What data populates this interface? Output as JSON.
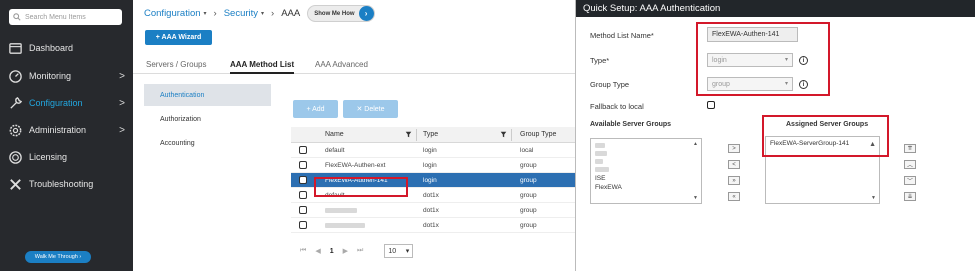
{
  "sidebar": {
    "search_placeholder": "Search Menu Items",
    "items": [
      {
        "label": "Dashboard",
        "icon": "dashboard-icon"
      },
      {
        "label": "Monitoring",
        "icon": "monitoring-icon",
        "chevron": ">"
      },
      {
        "label": "Configuration",
        "icon": "wrench-icon",
        "chevron": ">",
        "active": true
      },
      {
        "label": "Administration",
        "icon": "gear-icon",
        "chevron": ">"
      },
      {
        "label": "Licensing",
        "icon": "licensing-icon"
      },
      {
        "label": "Troubleshooting",
        "icon": "tools-icon"
      }
    ],
    "walk_me": "Walk Me Through ›"
  },
  "breadcrumb": {
    "configuration": "Configuration",
    "security": "Security",
    "current": "AAA",
    "show_me": "Show Me How"
  },
  "wizard_button": "+ AAA Wizard",
  "tabs": [
    "Servers / Groups",
    "AAA Method List",
    "AAA Advanced"
  ],
  "left_menu": [
    "Authentication",
    "Authorization",
    "Accounting"
  ],
  "actions": {
    "add": "+ Add",
    "delete": "✕ Delete"
  },
  "table": {
    "headers": [
      "Name",
      "Type",
      "Group Type"
    ],
    "rows": [
      {
        "name": "default",
        "type": "login",
        "group": "local"
      },
      {
        "name": "FlexEWA-Authen-ext",
        "type": "login",
        "group": "group"
      },
      {
        "name": "FlexEWA-Authen-141",
        "type": "login",
        "group": "group",
        "selected": true
      },
      {
        "name": "default",
        "type": "dot1x",
        "group": "group"
      },
      {
        "name": "",
        "type": "dot1x",
        "group": "group"
      },
      {
        "name": "",
        "type": "dot1x",
        "group": "group"
      }
    ]
  },
  "pager": {
    "first": "⏮",
    "prev": "◀",
    "page": "1",
    "next": "▶",
    "last": "⏭",
    "page_size": "10"
  },
  "quick_setup": {
    "title": "Quick Setup: AAA Authentication",
    "method_list_label": "Method List Name*",
    "method_list_value": "FlexEWA-Authen-141",
    "type_label": "Type*",
    "type_value": "login",
    "group_type_label": "Group Type",
    "group_type_value": "group",
    "fallback_label": "Fallback to local",
    "available_label": "Available Server Groups",
    "available_items": [
      "ISE",
      "FlexEWA"
    ],
    "assigned_label": "Assigned Server Groups",
    "assigned_items": [
      "FlexEWA-ServerGroup-141"
    ]
  },
  "colors": {
    "accent": "#1b7fc4",
    "highlight": "#d3182a",
    "sidebar": "#27292d",
    "selected_row": "#2c6fb2"
  }
}
